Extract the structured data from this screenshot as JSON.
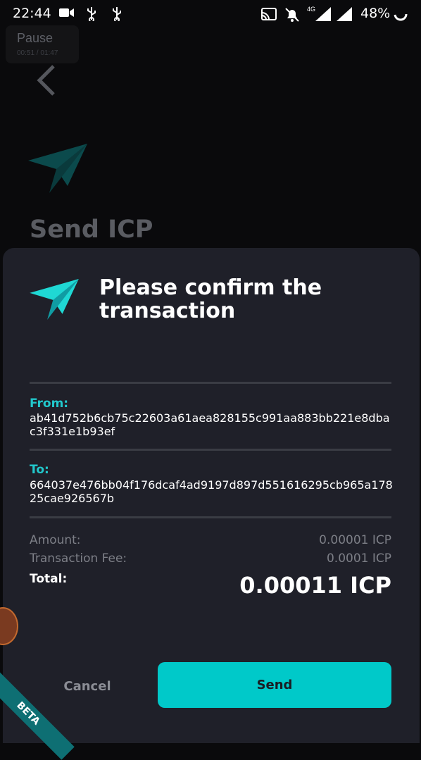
{
  "status_bar": {
    "time": "22:44",
    "battery": "48%",
    "network": "4G"
  },
  "overlay": {
    "pause_label": "Pause",
    "pause_time": "00:51 / 01:47"
  },
  "background": {
    "title": "Send ICP"
  },
  "dialog": {
    "title": "Please confirm the transaction",
    "from_label": "From:",
    "from_address": "ab41d752b6cb75c22603a61aea828155c991aa883bb221e8dbac3f331e1b93ef",
    "to_label": "To:",
    "to_address": "664037e476bb04f176dcaf4ad9197d897d551616295cb965a17825cae926567b",
    "amount_label": "Amount:",
    "amount_value": "0.00001 ICP",
    "fee_label": "Transaction Fee:",
    "fee_value": "0.0001 ICP",
    "total_label": "Total:",
    "total_value": "0.00011 ICP",
    "cancel_label": "Cancel",
    "send_label": "Send"
  },
  "badge": {
    "label": "BETA"
  },
  "colors": {
    "accent": "#00c9c9",
    "sheet_bg": "#1f2029",
    "label_accent": "#22c8cc"
  }
}
